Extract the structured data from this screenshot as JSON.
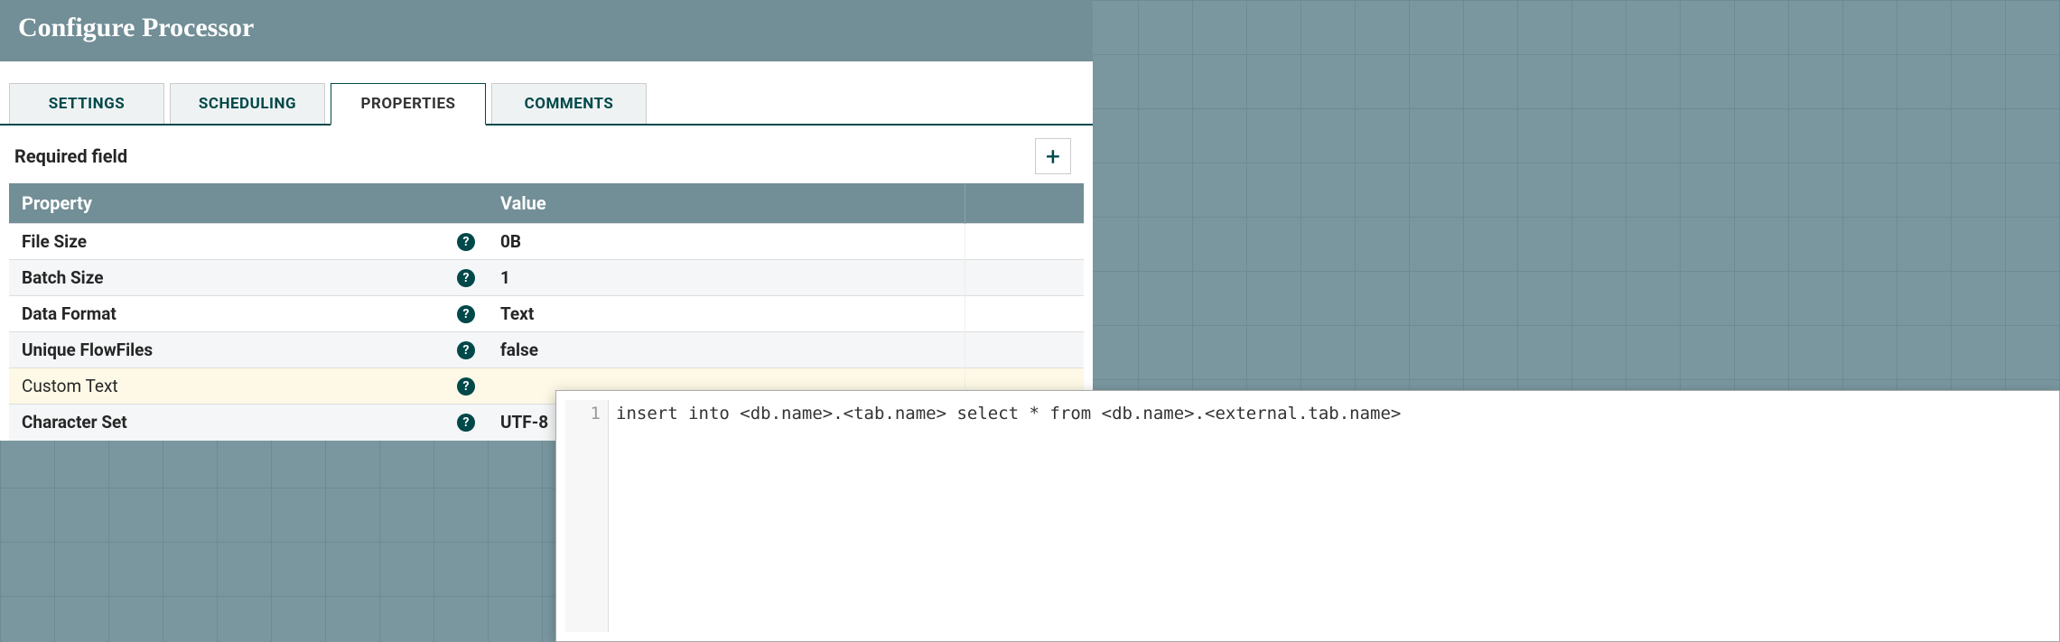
{
  "dialog": {
    "title": "Configure Processor",
    "required_label": "Required field"
  },
  "tabs": {
    "settings": "SETTINGS",
    "scheduling": "SCHEDULING",
    "properties": "PROPERTIES",
    "comments": "COMMENTS"
  },
  "table": {
    "header_property": "Property",
    "header_value": "Value",
    "rows": [
      {
        "name": "File Size",
        "value": "0B",
        "required": true
      },
      {
        "name": "Batch Size",
        "value": "1",
        "required": true
      },
      {
        "name": "Data Format",
        "value": "Text",
        "required": true
      },
      {
        "name": "Unique FlowFiles",
        "value": "false",
        "required": true
      },
      {
        "name": "Custom Text",
        "value": "",
        "required": false,
        "highlight": true
      },
      {
        "name": "Character Set",
        "value": "UTF-8",
        "required": true
      }
    ]
  },
  "editor": {
    "line_number": "1",
    "content": "insert into <db.name>.<tab.name> select * from <db.name>.<external.tab.name>"
  },
  "icons": {
    "help": "?",
    "plus": "+"
  }
}
